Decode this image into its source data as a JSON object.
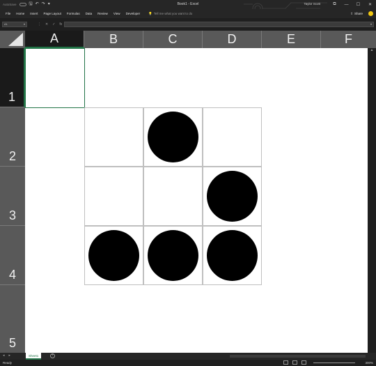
{
  "titlebar": {
    "autosave_label": "AutoSave",
    "title": "Book1 - Excel",
    "user": "Taylor Scott",
    "minimize": "—",
    "restore": "☐",
    "close": "✕"
  },
  "ribbon": {
    "tabs": [
      "File",
      "Home",
      "Insert",
      "Page Layout",
      "Formulas",
      "Data",
      "Review",
      "View",
      "Developer"
    ],
    "tell_me": "Tell me what you want to do",
    "share": "Share"
  },
  "formula_bar": {
    "name_box": "A1",
    "formula": "",
    "fx": "fx"
  },
  "grid": {
    "columns": [
      "A",
      "B",
      "C",
      "D",
      "E",
      "F"
    ],
    "rows": [
      "1",
      "2",
      "3",
      "4",
      "5"
    ],
    "selected_cell": "A1",
    "grid_cells": [
      "B2",
      "C2",
      "D2",
      "B3",
      "C3",
      "D3",
      "B4",
      "C4",
      "D4"
    ],
    "filled_cells": [
      "C2",
      "D3",
      "B4",
      "C4",
      "D4"
    ],
    "fill_color": "#000000"
  },
  "sheets": {
    "tabs": [
      "Sheet1"
    ],
    "add": "+"
  },
  "status": {
    "ready": "Ready",
    "zoom": "300%"
  },
  "colors": {
    "accent": "#217346",
    "header_bg": "#595959",
    "chrome_bg": "#262626"
  }
}
